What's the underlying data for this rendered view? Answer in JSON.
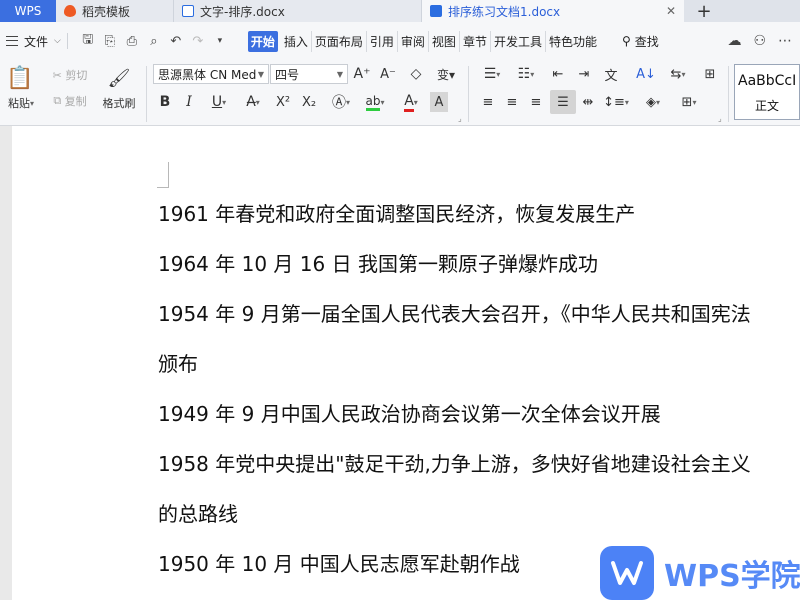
{
  "tabs": {
    "wps": "WPS",
    "template": "稻壳模板",
    "doc1": "文字-排序.docx",
    "doc2": "排序练习文档1.docx",
    "new_tab": "+"
  },
  "menu": {
    "file": "文件",
    "tabs": [
      "开始",
      "插入",
      "页面布局",
      "引用",
      "审阅",
      "视图",
      "章节",
      "开发工具",
      "特色功能"
    ],
    "search": "查找"
  },
  "ribbon": {
    "paste": "粘贴",
    "cut": "剪切",
    "copy": "复制",
    "format_painter": "格式刷",
    "font_name": "思源黑体 CN Med",
    "font_size": "四号",
    "bold": "B",
    "italic": "I",
    "underline": "U",
    "style_preview": "AaBbCcI",
    "style_name": "正文"
  },
  "document": {
    "lines": [
      "1961 年春党和政府全面调整国民经济，恢复发展生产",
      "1964 年 10 月 16 日  我国第一颗原子弹爆炸成功",
      "1954 年 9 月第一届全国人民代表大会召开，《中华人民共和国宪法",
      "颁布",
      "1949 年 9 月中国人民政治协商会议第一次全体会议开展",
      "1958 年党中央提出\"鼓足干劲,力争上游，多快好省地建设社会主义",
      "的总路线",
      "1950 年 10 月  中国人民志愿军赴朝作战"
    ]
  },
  "watermark": {
    "text": "WPS学院"
  },
  "colors": {
    "accent": "#3b6fe0",
    "font_color_red": "#e02020",
    "highlight_green": "#2ecc40",
    "font_color_blue": "#1a4be0"
  }
}
